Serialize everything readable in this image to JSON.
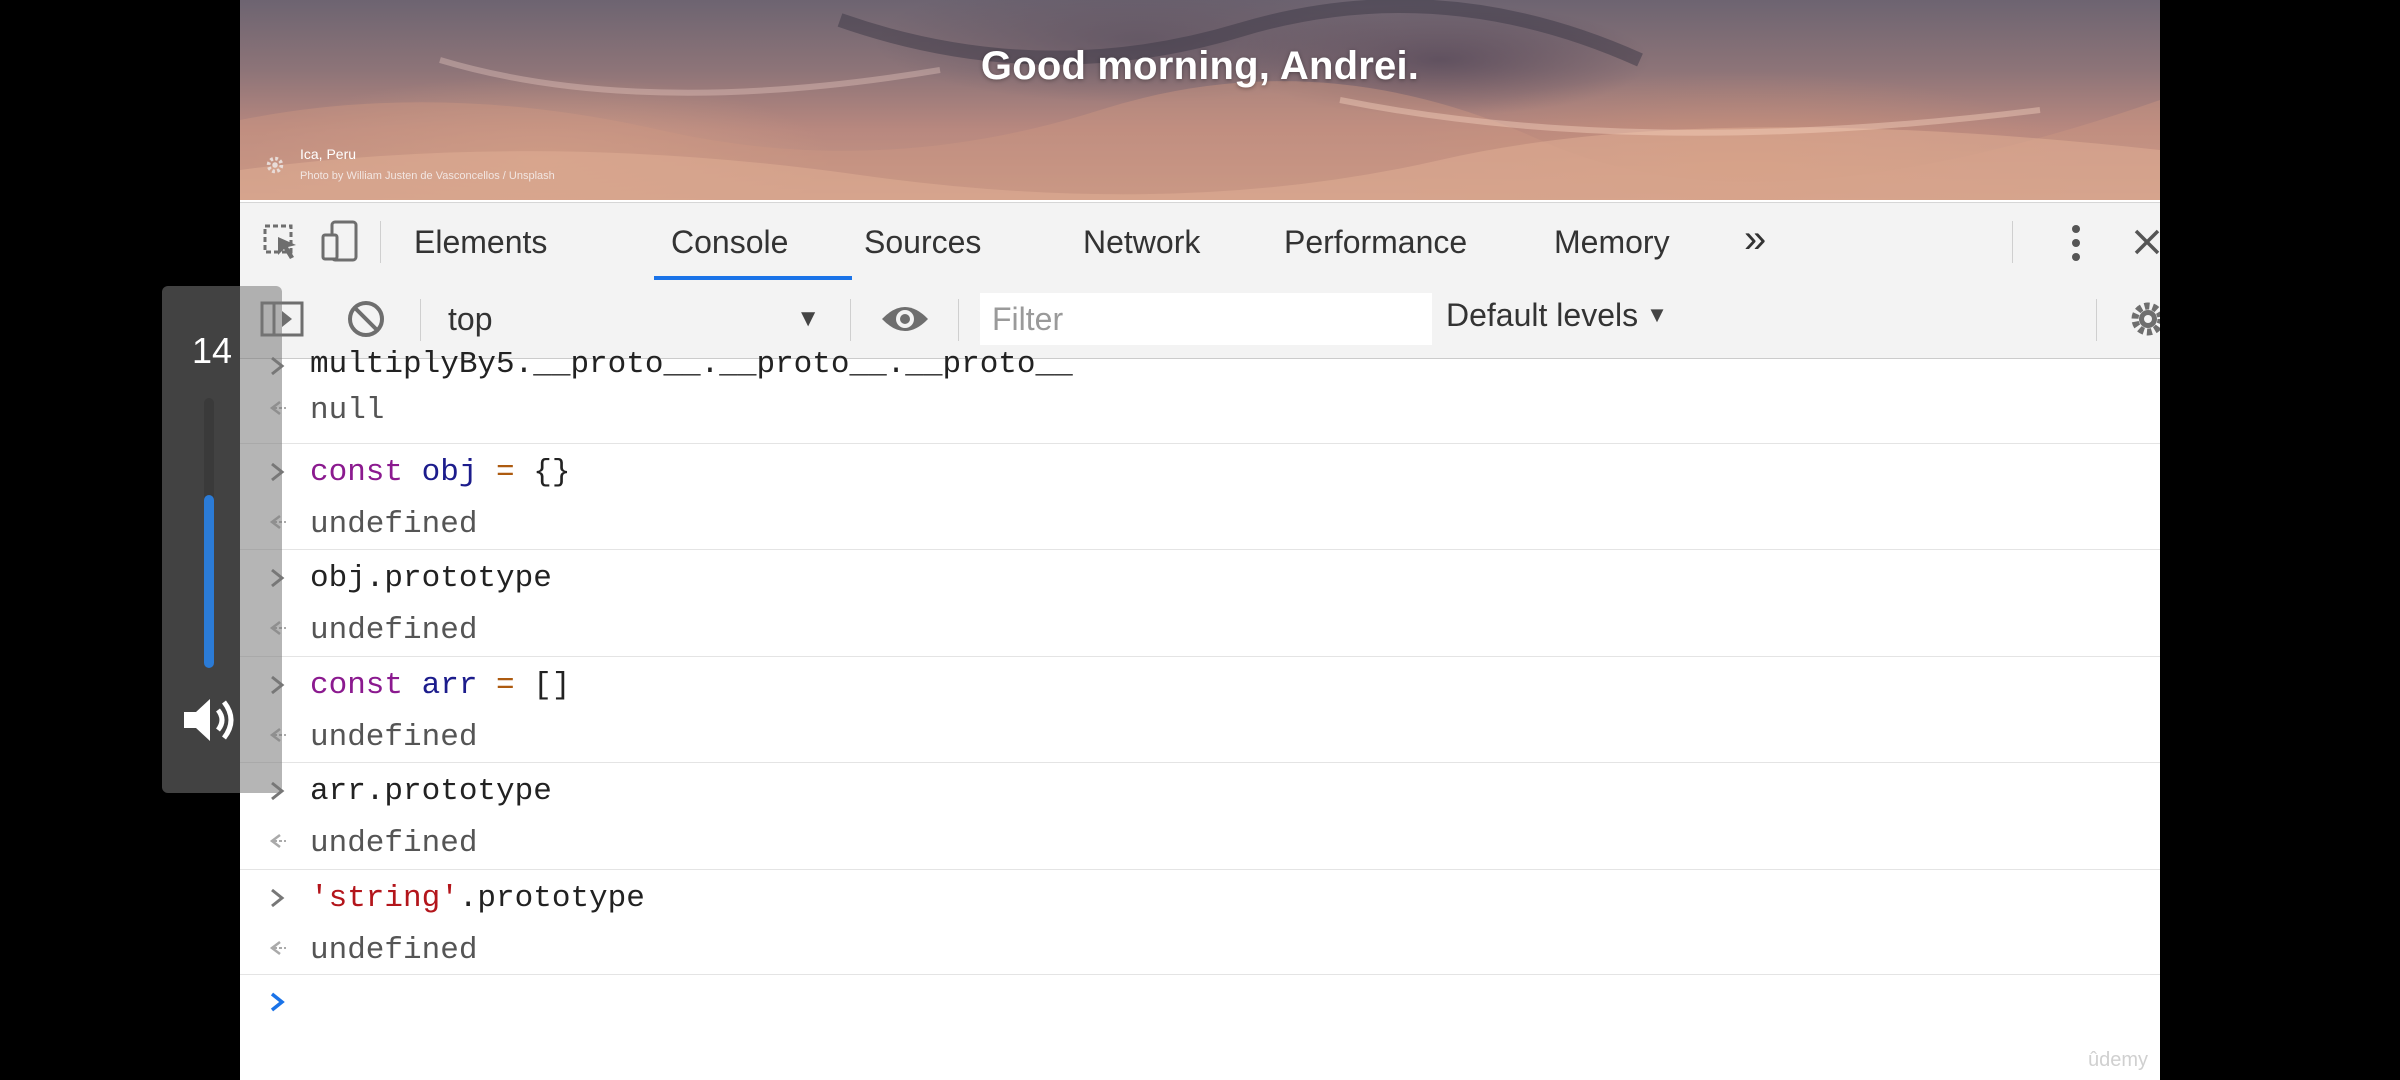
{
  "hero": {
    "greeting": "Good morning, Andrei.",
    "location": "Ica, Peru",
    "credit": "Photo by William Justen de Vasconcellos / Unsplash"
  },
  "devtools": {
    "tabs": [
      "Elements",
      "Console",
      "Sources",
      "Network",
      "Performance",
      "Memory"
    ],
    "active_tab": "Console",
    "more_tabs": "»",
    "accent": "#1a73e8"
  },
  "toolbar": {
    "context": "top",
    "filter_placeholder": "Filter",
    "levels": "Default levels"
  },
  "console": {
    "entries": [
      {
        "input": "multiplyBy5.__proto__.__proto__.__proto__",
        "output": "null"
      },
      {
        "input": "const obj = {}",
        "output": "undefined"
      },
      {
        "input": "obj.prototype",
        "output": "undefined"
      },
      {
        "input": "const arr = []",
        "output": "undefined"
      },
      {
        "input": "arr.prototype",
        "output": "undefined"
      },
      {
        "input": "'string'.prototype",
        "output": "undefined"
      }
    ],
    "watermark": "ûdemy"
  },
  "player": {
    "volume_label": "14",
    "volume_level": 0.64
  }
}
